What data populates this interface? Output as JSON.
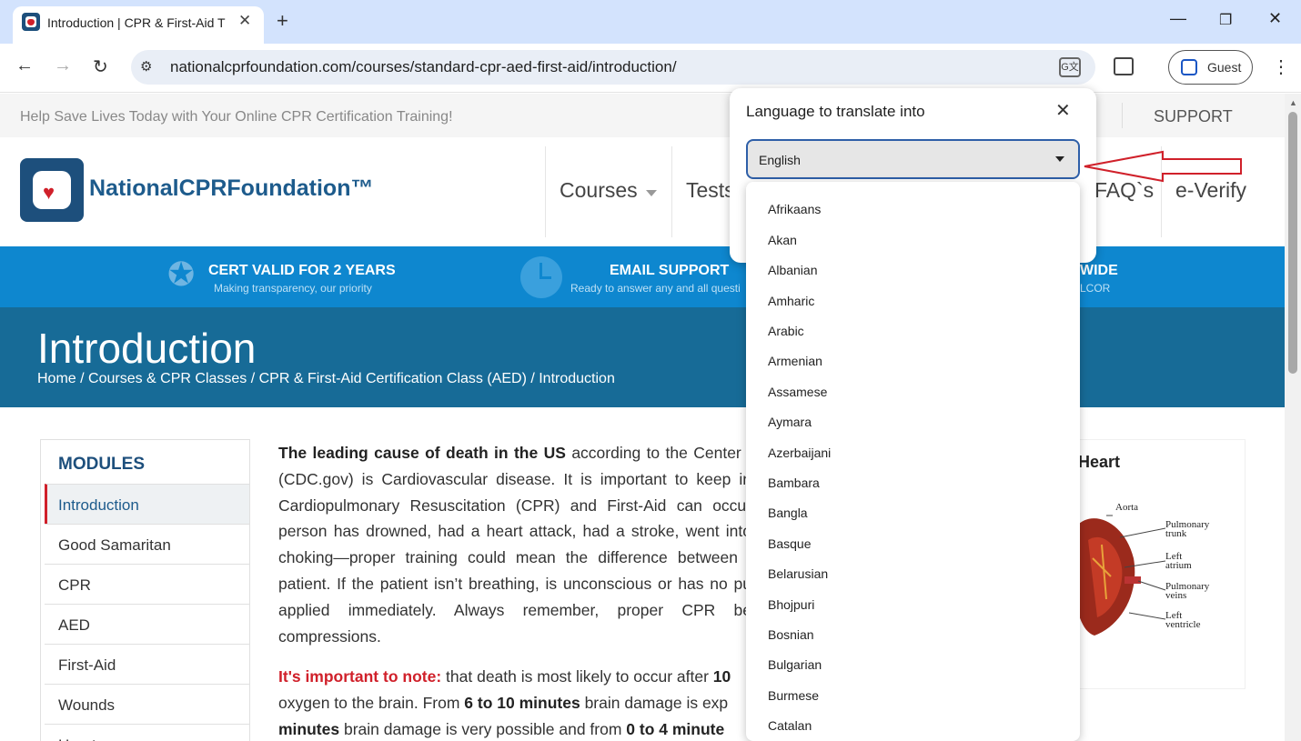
{
  "browser": {
    "tab_title": "Introduction | CPR & First-Aid T",
    "new_tab": "+",
    "url": "nationalcprfoundation.com/courses/standard-cpr-aed-first-aid/introduction/",
    "profile_label": "Guest",
    "translate_icon": "translate-icon"
  },
  "site": {
    "top_strip": "Help Save Lives Today with Your Online CPR Certification Training!",
    "support": "SUPPORT",
    "logo_text": "NationalCPRFoundation™",
    "nav": {
      "courses": "Courses",
      "tests": "Tests",
      "faqs": "FAQ`s",
      "everify": "e-Verify"
    },
    "bluebar": {
      "item1_title": "CERT VALID FOR 2 YEARS",
      "item1_sub": "Making transparency, our priority",
      "item2_title": "EMAIL SUPPORT",
      "item2_sub": "Ready to answer any and all questi",
      "item3_title": "WIDE",
      "item3_sub": "LCOR"
    },
    "hero": {
      "title": "Introduction",
      "breadcrumb": "Home / Courses & CPR Classes / CPR & First-Aid Certification Class (AED) / Introduction"
    },
    "modules": {
      "heading": "MODULES",
      "items": [
        "Introduction",
        "Good Samaritan",
        "CPR",
        "AED",
        "First-Aid",
        "Wounds",
        "Heart"
      ]
    },
    "article": {
      "p1_bold": "The leading cause of death in the US",
      "p1_lines": [
        "according to the Center f",
        "(CDC.gov) is Cardiovascular disease. It is important to keep in",
        "Cardiopulmonary Resuscitation (CPR) and First-Aid can occur",
        "person has drowned, had a heart attack, had a stroke, went into",
        "choking—proper training could mean the difference between l",
        "patient. If the patient isn’t breathing, is unconscious or has no pu",
        "applied immediately. Always remember, proper CPR be",
        "compressions."
      ],
      "p2_red": "It's important to note:",
      "p2_a": "that death is most likely to occur after",
      "p2_b1": "10",
      "p2_c": "oxygen to the brain. From",
      "p2_b2": "6 to 10 minutes",
      "p2_d": "brain damage is exp",
      "p2_b3": "minutes",
      "p2_e": "brain damage is very possible and from",
      "p2_b4": "0 to 4 minute"
    },
    "heart_card": {
      "title": "n Heart",
      "labels": [
        "Aorta",
        "Pulmonary trunk",
        "Left atrium",
        "Pulmonary veins",
        "Left ventricle"
      ]
    }
  },
  "translate_popup": {
    "title": "Language to translate into",
    "selected": "English",
    "options": [
      "Afrikaans",
      "Akan",
      "Albanian",
      "Amharic",
      "Arabic",
      "Armenian",
      "Assamese",
      "Aymara",
      "Azerbaijani",
      "Bambara",
      "Bangla",
      "Basque",
      "Belarusian",
      "Bhojpuri",
      "Bosnian",
      "Bulgarian",
      "Burmese",
      "Catalan"
    ]
  },
  "colors": {
    "brand_blue": "#1d4f7c",
    "bar_blue": "#0e87cf",
    "hero_blue": "#176b97",
    "accent_red": "#d0202a"
  }
}
